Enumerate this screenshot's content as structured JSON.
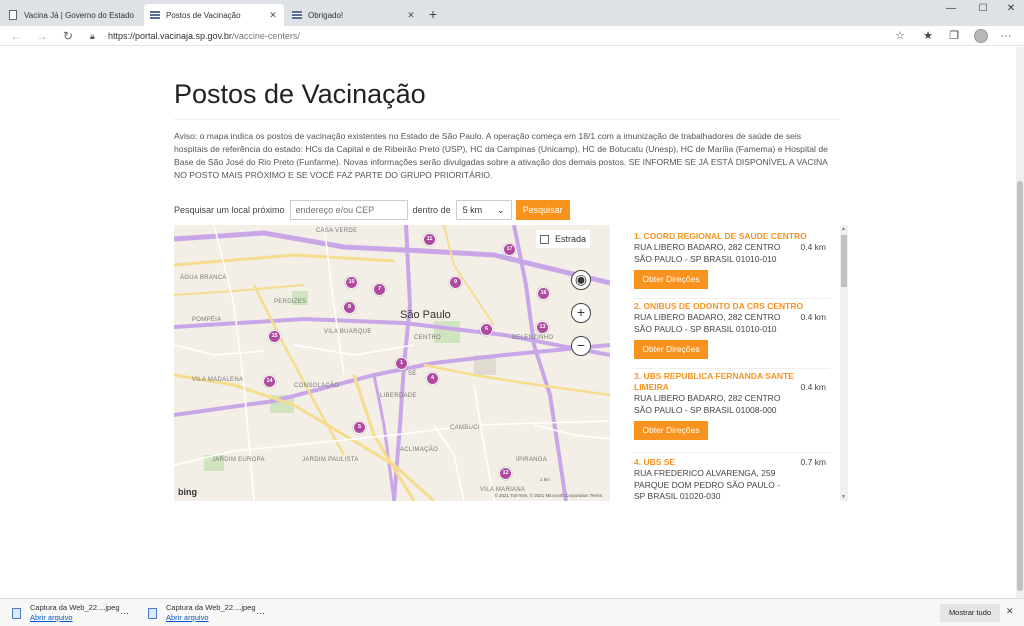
{
  "browser": {
    "tabs": [
      {
        "label": "Vacina Já | Governo do Estado d",
        "active": false
      },
      {
        "label": "Postos de Vacinação",
        "active": true
      },
      {
        "label": "Obrigado!",
        "active": false
      }
    ],
    "url_host": "https://portal.vacinaja.sp.gov.br",
    "url_path": "/vaccine-centers/"
  },
  "page": {
    "title": "Postos de Vacinação",
    "notice": "Aviso: o mapa indica os postos de vacinação existentes no Estado de São Paulo. A operação começa em 18/1 com a imunização de trabalhadores de saúde de seis hospitais de referência do estado: HCs da Capital e de Ribeirão Preto (USP), HC da Campinas (Unicamp), HC de Botucatu (Unesp), HC de Marília (Famema) e Hospital de Base de São José do Rio Preto (Funfarme). Novas informações serão divulgadas sobre a ativação dos demais postos. SE INFORME SE JÁ ESTÁ DISPONÍVEL A VACINA NO POSTO MAIS PRÓXIMO E SE VOCÊ FAZ PARTE DO GRUPO PRIORITÁRIO."
  },
  "search": {
    "label": "Pesquisar um local próximo",
    "placeholder": "endereço e/ou CEP",
    "within_label": "dentro de",
    "distance": "5 km",
    "button": "Pesquisar"
  },
  "map": {
    "layer_toggle": "Estrada",
    "city": "São Paulo",
    "brand": "bing",
    "copyright": "© 2021 TomTom, © 2021 Microsoft Corporation  Terms",
    "scale": "1 km",
    "labels": [
      {
        "text": "Casa Verde"
      },
      {
        "text": "Água Branca"
      },
      {
        "text": "Perdizes"
      },
      {
        "text": "Vila Buarque"
      },
      {
        "text": "Consolação"
      },
      {
        "text": "Liberdade"
      },
      {
        "text": "Aclimação"
      },
      {
        "text": "Jardim Paulista"
      },
      {
        "text": "Jardim Europa"
      },
      {
        "text": "Vila Mariana"
      },
      {
        "text": "Belenzinho"
      },
      {
        "text": "Centro"
      },
      {
        "text": "Sé"
      },
      {
        "text": "Pompéia"
      },
      {
        "text": "Vila Madalena"
      },
      {
        "text": "Cambuci"
      },
      {
        "text": "Ipiranga"
      }
    ],
    "pins": [
      {
        "n": "1"
      },
      {
        "n": "4"
      },
      {
        "n": "5"
      },
      {
        "n": "6"
      },
      {
        "n": "7"
      },
      {
        "n": "8"
      },
      {
        "n": "9"
      },
      {
        "n": "10"
      },
      {
        "n": "11"
      },
      {
        "n": "12"
      },
      {
        "n": "13"
      },
      {
        "n": "14"
      },
      {
        "n": "15"
      },
      {
        "n": "16"
      },
      {
        "n": "17"
      }
    ]
  },
  "results": [
    {
      "name": "1. COORD REGIONAL DE SAUDE CENTRO",
      "address": "RUA LIBERO BADARO, 282 CENTRO SÃO PAULO - SP BRASIL 01010-010",
      "distance": "0.4 km",
      "button": "Obter Direções"
    },
    {
      "name": "2. ONIBUS DE ODONTO DA CRS CENTRO",
      "address": "RUA LIBERO BADARO, 282 CENTRO SÃO PAULO - SP BRASIL 01010-010",
      "distance": "0.4 km",
      "button": "Obter Direções"
    },
    {
      "name": "3. UBS REPUBLICA FERNANDA SANTE LIMEIRA",
      "address": "RUA LIBERO BADARO, 282 CENTRO SÃO PAULO - SP BRASIL 01008-000",
      "distance": "0.4 km",
      "button": "Obter Direções"
    },
    {
      "name": "4. UBS SE",
      "address": "RUA FREDERICO ALVARENGA, 259 PARQUE DOM PEDRO SÃO PAULO - SP BRASIL 01020-030",
      "distance": "0.7 km",
      "button": "Obter Direções"
    }
  ],
  "downloads": {
    "items": [
      {
        "file": "Captura da Web_22....jpeg",
        "action": "Abrir arquivo"
      },
      {
        "file": "Captura da Web_22....jpeg",
        "action": "Abrir arquivo"
      }
    ],
    "show_all": "Mostrar tudo"
  },
  "colors": {
    "accent": "#f7931e",
    "pin": "#b04aa0",
    "road_major": "#c9a6e8"
  }
}
